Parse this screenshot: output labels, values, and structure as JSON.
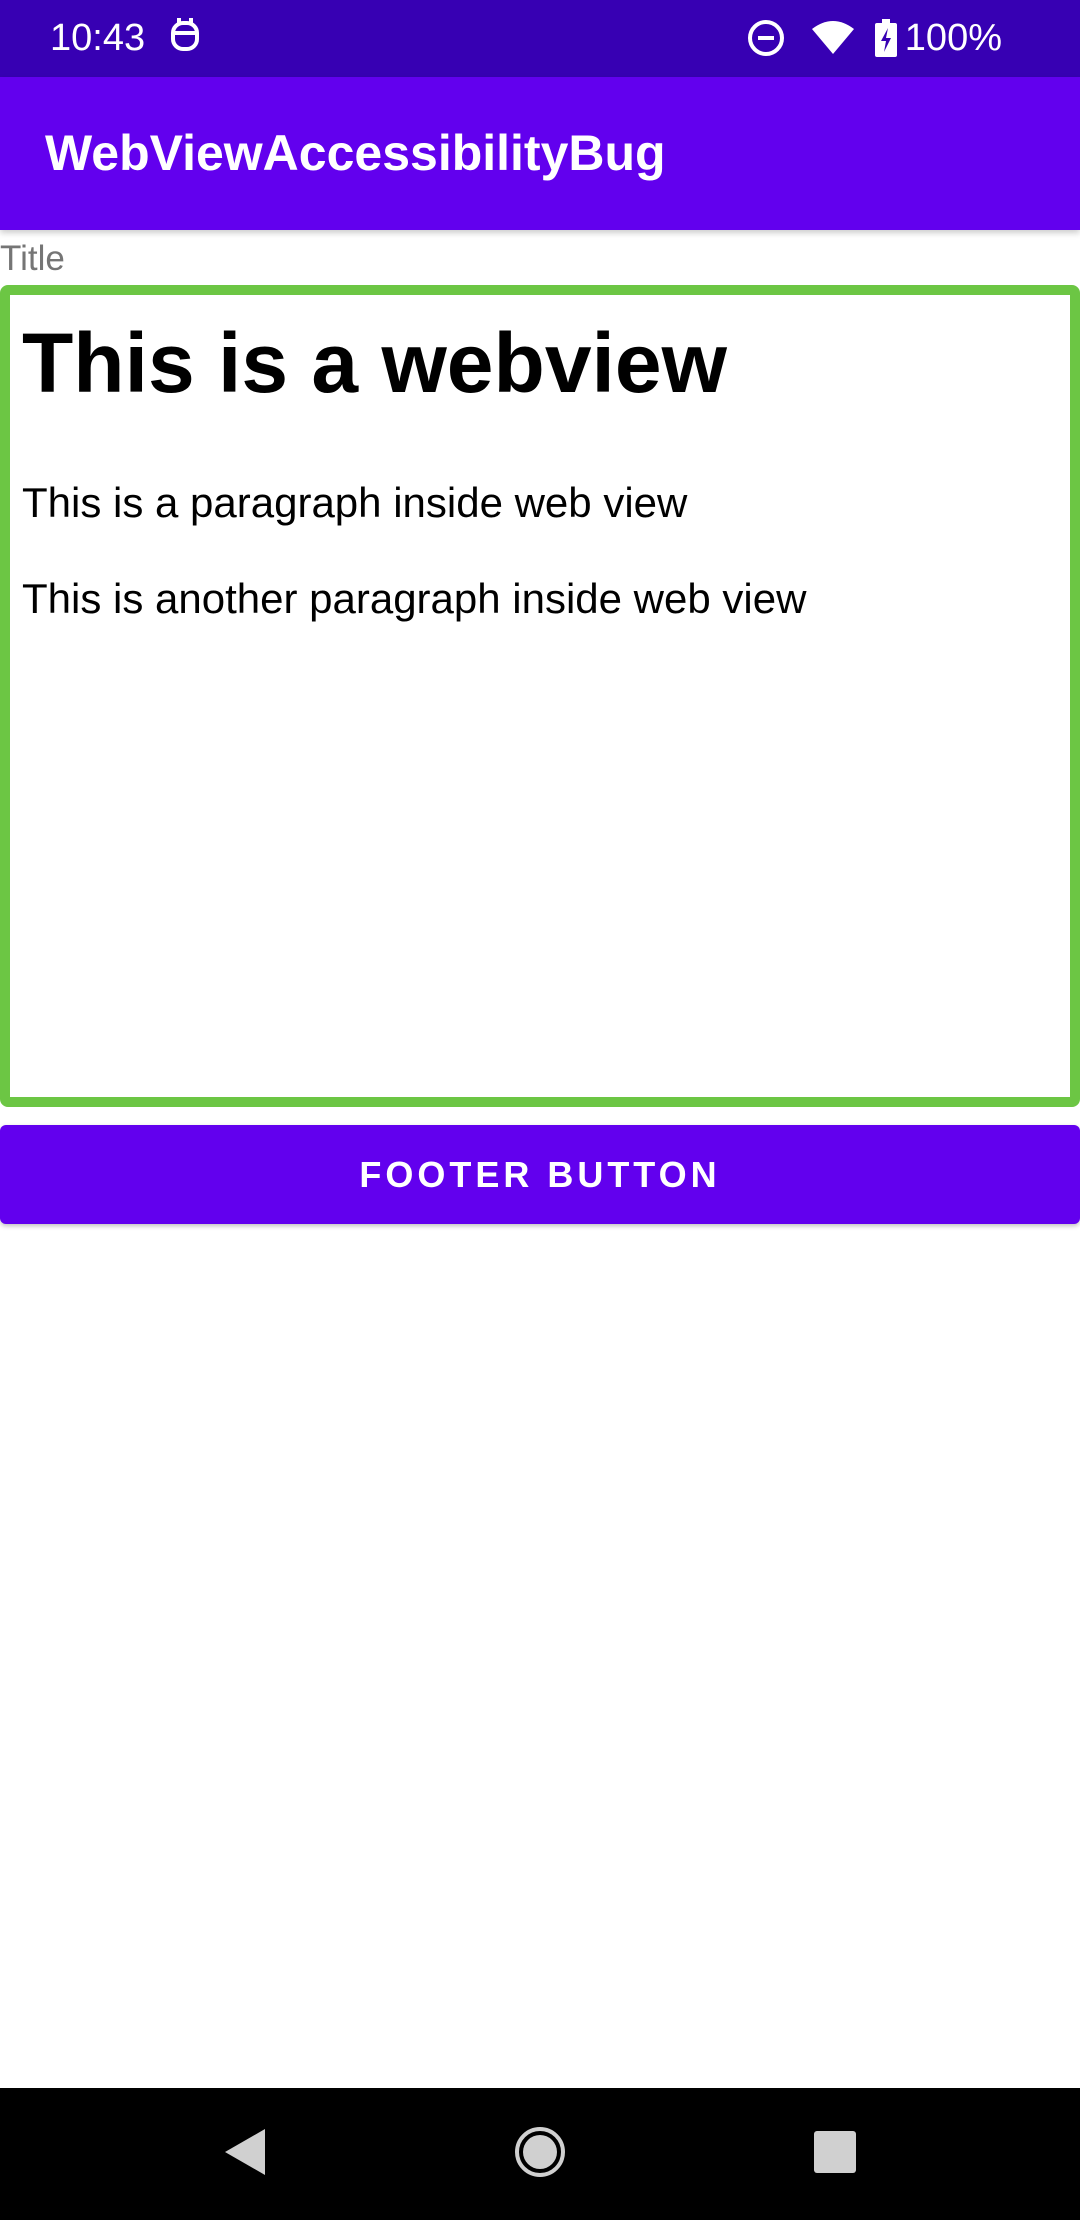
{
  "status_bar": {
    "time": "10:43",
    "battery_text": "100%",
    "icons": [
      "app-notification-icon",
      "do-not-disturb-icon",
      "wifi-icon",
      "battery-charging-icon"
    ]
  },
  "app_bar": {
    "title": "WebViewAccessibilityBug"
  },
  "title_label": "Title",
  "webview": {
    "heading": "This is a webview",
    "paragraphs": [
      "This is a paragraph inside web view",
      "This is another paragraph inside web view"
    ],
    "border_color": "#6cc644"
  },
  "footer_button": {
    "label": "FOOTER BUTTON"
  },
  "nav_bar": {
    "icons": [
      "back-icon",
      "home-icon",
      "recents-icon"
    ]
  },
  "colors": {
    "status_bar": "#3700b3",
    "primary": "#6200ee",
    "webview_border": "#6cc644"
  }
}
